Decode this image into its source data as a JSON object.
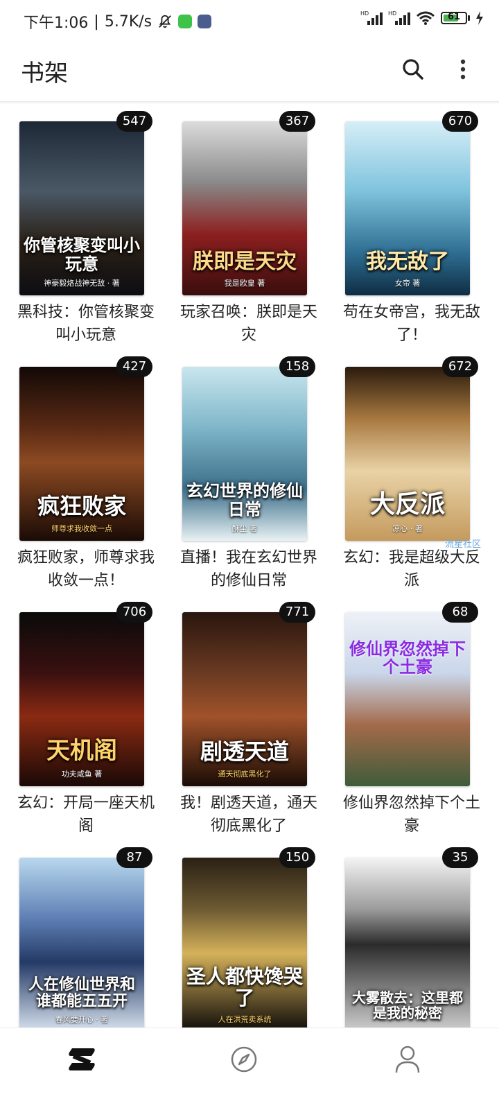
{
  "status_bar": {
    "time": "下午1:06",
    "net_speed": "5.7K/s",
    "hd1": "HD",
    "hd2": "HD",
    "battery": "61"
  },
  "header": {
    "title": "书架"
  },
  "books": [
    {
      "title": "黑科技：你管核聚变叫小玩意",
      "cover_text": "你管核聚变叫小玩意",
      "cover_author": "神豪毅烙战神无敌 · 著",
      "count": "547"
    },
    {
      "title": "玩家召唤：朕即是天灾",
      "cover_text": "朕即是天灾",
      "cover_author": "我是欧皇 著",
      "count": "367"
    },
    {
      "title": "苟在女帝宫，我无敌了！",
      "cover_text": "我无敌了",
      "cover_author": "女帝 著",
      "count": "670"
    },
    {
      "title": "疯狂败家，师尊求我收敛一点！",
      "cover_text": "疯狂败家",
      "cover_author": "师尊求我收敛一点",
      "count": "427"
    },
    {
      "title": "直播！我在玄幻世界的修仙日常",
      "cover_text": "玄幻世界的修仙日常",
      "cover_author": "酥尘 著",
      "count": "158"
    },
    {
      "title": "玄幻：我是超级大反派",
      "cover_text": "大反派",
      "cover_author": "凉心 · 著",
      "count": "672"
    },
    {
      "title": "玄幻：开局一座天机阁",
      "cover_text": "天机阁",
      "cover_author": "功夫咸鱼 著",
      "count": "706"
    },
    {
      "title": "我！剧透天道，通天彻底黑化了",
      "cover_text": "剧透天道",
      "cover_author": "通天彻底黑化了",
      "count": "771"
    },
    {
      "title": "修仙界忽然掉下个土豪",
      "cover_text": "修仙界忽然掉下个土豪",
      "cover_author": "",
      "count": "68"
    },
    {
      "title": "",
      "cover_text": "人在修仙世界和谁都能五五开",
      "cover_author": "春风要开心 · 著",
      "count": "87"
    },
    {
      "title": "",
      "cover_text": "圣人都快馋哭了",
      "cover_author": "人在洪荒卖系统",
      "count": "150"
    },
    {
      "title": "",
      "cover_text": "大雾散去：这里都是我的秘密",
      "cover_author": "",
      "count": "35"
    }
  ],
  "watermark": "流星社区",
  "colors": {
    "badge_bg": "#111111",
    "text": "#222222",
    "battery_fill": "#4caf50"
  },
  "bottom_nav": {
    "icons": [
      "bookshelf-icon",
      "compass-icon",
      "profile-icon"
    ]
  }
}
